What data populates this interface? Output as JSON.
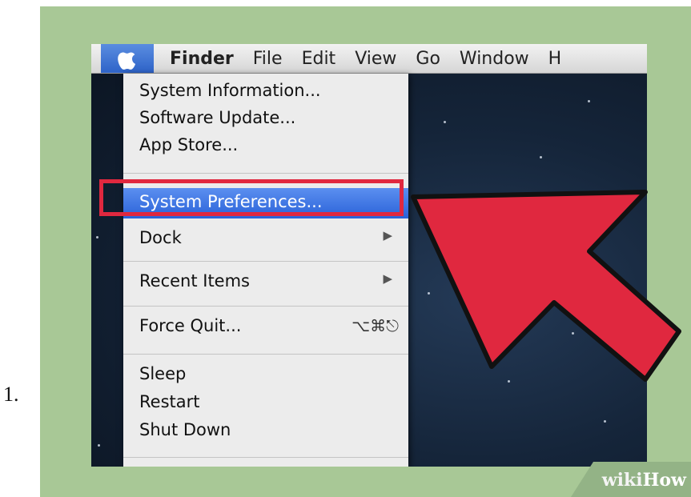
{
  "step": {
    "number": "1."
  },
  "menubar": {
    "apple_icon": "apple-icon",
    "items": [
      "Finder",
      "File",
      "Edit",
      "View",
      "Go",
      "Window",
      "H"
    ]
  },
  "apple_menu": {
    "items": [
      {
        "label": "System Information..."
      },
      {
        "label": "Software Update..."
      },
      {
        "label": "App Store..."
      },
      {
        "label": "System Preferences...",
        "highlighted": true
      },
      {
        "label": "Dock",
        "submenu": true
      },
      {
        "label": "Recent Items",
        "submenu": true
      },
      {
        "label": "Force Quit...",
        "shortcut": "⌥⌘⎋"
      },
      {
        "label": "Sleep"
      },
      {
        "label": "Restart"
      },
      {
        "label": "Shut Down"
      }
    ],
    "submenu_icon": "▶"
  },
  "annotation": {
    "highlight_color": "#e0283f",
    "arrow_color": "#e0283f"
  },
  "branding": {
    "logo": {
      "part1": "wiki",
      "part2": "How"
    }
  },
  "colors": {
    "frame_background": "#a8c896",
    "menu_highlight": "#2a62d8"
  }
}
